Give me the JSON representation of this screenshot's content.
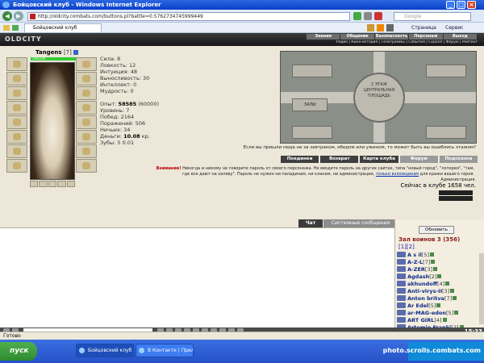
{
  "window": {
    "title": "Бойцовский клуб - Windows Internet Explorer",
    "minimize": "_",
    "maximize": "□",
    "close": "×"
  },
  "browser": {
    "url": "http://oldcity.combats.com/buttons.pl?battle=0.5762734745999449",
    "search_placeholder": "Google",
    "tab_title": "Бойцовский клуб",
    "tools": {
      "page": "Страница",
      "service": "Сервис"
    }
  },
  "site": {
    "logo": "OLDCITY",
    "menu": [
      "Знания",
      "Общение",
      "Безопасность",
      "Персонаж",
      "Выход"
    ],
    "submenu": "Радио | Кино-история | Телеграммы | События | Скролл | Форум | Рейтинг"
  },
  "character": {
    "name": "Tangens",
    "level": "[7]",
    "hp": "246/246"
  },
  "stats": {
    "strength": "Сила: 8",
    "agility": "Ловкость: 12",
    "intuition": "Интуиция: 48",
    "endurance": "Выносливость: 30",
    "intellect": "Интеллект: 0",
    "wisdom": "Мудрость: 0",
    "exp_label": "Опыт: ",
    "exp_value": "58585",
    "exp_next": " (60000)",
    "level": "Уровень: 7",
    "wins": "Побед: 2164",
    "losses": "Поражений: 506",
    "draws": "Ничьих: 34",
    "money_label": "Деньги: ",
    "money_value": "10.08",
    "money_unit": " кр.",
    "teeth": "Зубы: 5 0.01"
  },
  "map": {
    "hub": "2 ЭТАЖ\nЦЕНТРАЛЬНАЯ\nПЛОЩАДЬ",
    "hall_left": "ЗАЛЫ"
  },
  "quote": "Если вы пришли сюда не за завтраком, обедом или ужином, то может быть вы ошиблись этажом?",
  "page_buttons": [
    "Поединки",
    "Возврат",
    "Карта клуба",
    "Форум",
    "Подсказка"
  ],
  "warning": {
    "label": "Внимание!",
    "text": " Никогда и никому не говорите пароль от своего персонажа. Не вводите пароль на других сайтах, типа \"новый город\", \"лотерея\", \"там, где все дают на халяву\". Пароль не нужен ни паладинам, ни кланам, ни администрации,",
    "link": "только взломщикам",
    "tail": " для кражи вашего героя."
  },
  "admin": "Администрация.",
  "online": "Сейчас в клубе 1658 чел.",
  "chat": {
    "tab_chat": "Чат",
    "tab_system": "Системные сообщения",
    "refresh": "Обновить",
    "room": "Зал воинов 3 (356)",
    "pages": [
      "[1]",
      "[2]"
    ],
    "users": [
      {
        "name": "A s il",
        "lvl": "[5]"
      },
      {
        "name": "A-Z-L",
        "lvl": "[7]"
      },
      {
        "name": "A-ZER",
        "lvl": "[3]"
      },
      {
        "name": "Agdash",
        "lvl": "[2]"
      },
      {
        "name": "akhundoff",
        "lvl": "[4]"
      },
      {
        "name": "Anti-virys-II",
        "lvl": "[3]"
      },
      {
        "name": "Anton britva",
        "lvl": "[7]"
      },
      {
        "name": "Ar Edel",
        "lvl": "[5]"
      },
      {
        "name": "ar-MAG-edon",
        "lvl": "[5]"
      },
      {
        "name": "ART GIRL",
        "lvl": "[4]"
      },
      {
        "name": "Artemio Franki",
        "lvl": "[2]"
      }
    ],
    "clock": "15:33"
  },
  "statusbar": "Готово",
  "taskbar": {
    "start": "пуск",
    "items": [
      "Бойцовский клуб - ...",
      "В Контакте | Прило..."
    ]
  },
  "watermark": "photo.scrolls.combats.com"
}
